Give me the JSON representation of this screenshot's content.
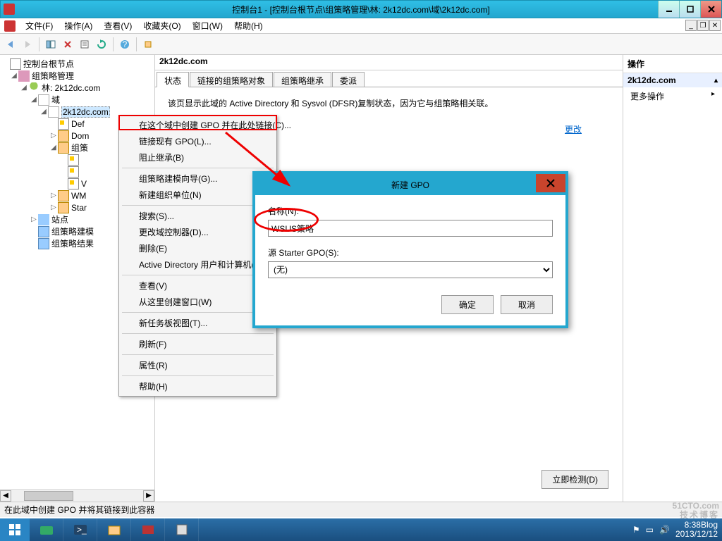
{
  "window": {
    "title": "控制台1 - [控制台根节点\\组策略管理\\林: 2k12dc.com\\域\\2k12dc.com]"
  },
  "menubar": {
    "items": [
      "文件(F)",
      "操作(A)",
      "查看(V)",
      "收藏夹(O)",
      "窗口(W)",
      "帮助(H)"
    ]
  },
  "tree": {
    "root": "控制台根节点",
    "gpm": "组策略管理",
    "forest": "林: 2k12dc.com",
    "domains": "域",
    "domain": "2k12dc.com",
    "items": [
      "Def",
      "Dom",
      "组策",
      "WM",
      "Star"
    ],
    "sites": "站点",
    "modeling": "组策略建模",
    "results": "组策略结果"
  },
  "content": {
    "header": "2k12dc.com",
    "tabs": [
      "状态",
      "链接的组策略对象",
      "组策略继承",
      "委派"
    ],
    "active_tab": 0,
    "info": "该页显示此域的 Active Directory 和 Sysvol (DFSR)复制状态，因为它与组策略相关联。",
    "more": "更改",
    "detect_btn": "立即检测(D)"
  },
  "actions": {
    "title": "操作",
    "header": "2k12dc.com",
    "item": "更多操作"
  },
  "context_menu": {
    "items": [
      {
        "label": "在这个域中创建 GPO 并在此处链接(C)...",
        "group": 0
      },
      {
        "label": "链接现有 GPO(L)...",
        "group": 0
      },
      {
        "label": "阻止继承(B)",
        "group": 0
      },
      {
        "label": "组策略建模向导(G)...",
        "group": 1
      },
      {
        "label": "新建组织单位(N)",
        "group": 1
      },
      {
        "label": "搜索(S)...",
        "group": 2
      },
      {
        "label": "更改域控制器(D)...",
        "group": 2
      },
      {
        "label": "删除(E)",
        "group": 2
      },
      {
        "label": "Active Directory 用户和计算机(",
        "group": 2
      },
      {
        "label": "查看(V)",
        "group": 3
      },
      {
        "label": "从这里创建窗口(W)",
        "group": 3
      },
      {
        "label": "新任务板视图(T)...",
        "group": 4
      },
      {
        "label": "刷新(F)",
        "group": 5
      },
      {
        "label": "属性(R)",
        "group": 6
      },
      {
        "label": "帮助(H)",
        "group": 7
      }
    ]
  },
  "dialog": {
    "title": "新建 GPO",
    "name_label": "名称(N):",
    "name_value": "WSUS策略",
    "source_label": "源 Starter GPO(S):",
    "source_value": "(无)",
    "ok": "确定",
    "cancel": "取消"
  },
  "statusbar": {
    "text": "在此域中创建 GPO 并将其链接到此容器"
  },
  "tray": {
    "time": "8:38",
    "date": "2013/12/12",
    "blog": "Blog"
  },
  "watermark": {
    "line1": "51CTO.com",
    "line2": "技术博客"
  }
}
